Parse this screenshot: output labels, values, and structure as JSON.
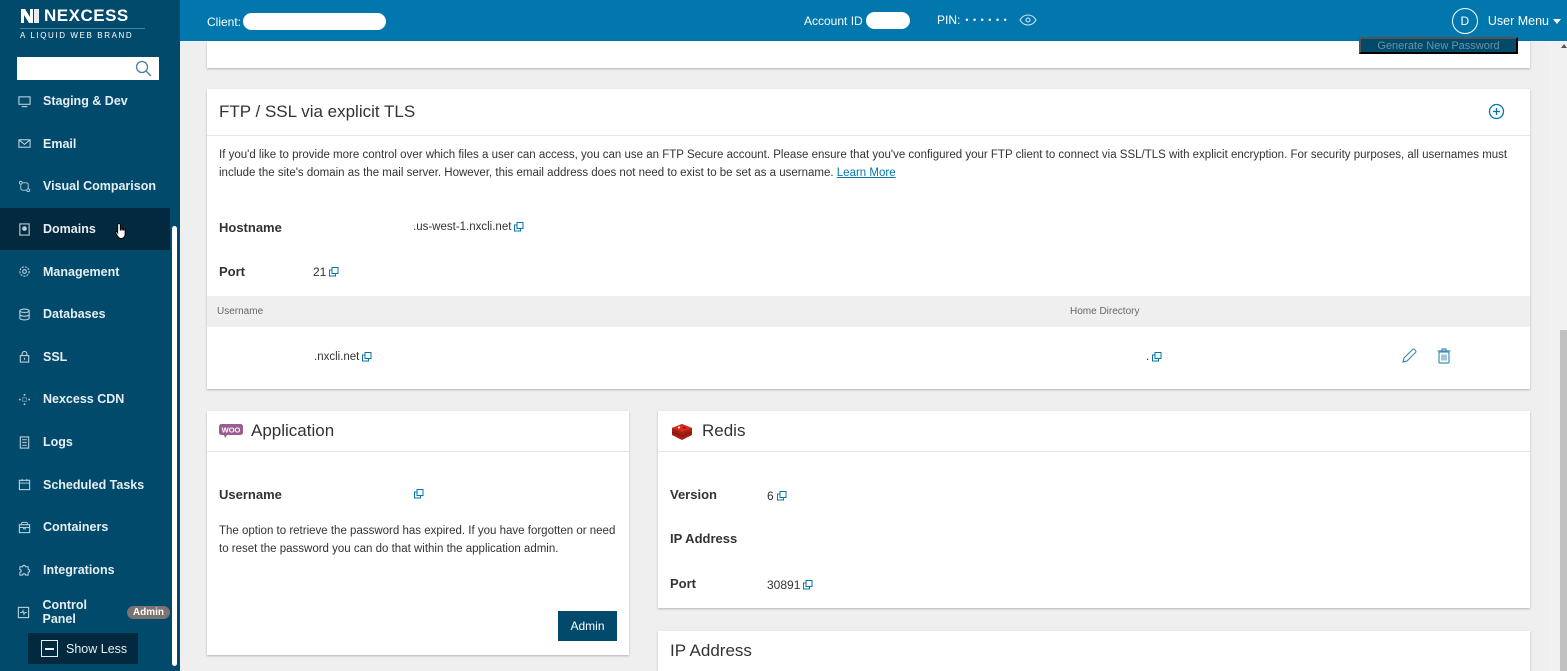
{
  "brand": {
    "name": "NEXCESS",
    "tagline": "A LIQUID WEB BRAND"
  },
  "sidebar": {
    "search_placeholder": "",
    "items": [
      {
        "label": "Staging & Dev",
        "icon": "monitor-icon",
        "active": false
      },
      {
        "label": "Email",
        "icon": "envelope-icon",
        "active": false
      },
      {
        "label": "Visual Comparison",
        "icon": "compare-icon",
        "active": false
      },
      {
        "label": "Domains",
        "icon": "domain-icon",
        "active": true
      },
      {
        "label": "Management",
        "icon": "gear-icon",
        "active": false
      },
      {
        "label": "Databases",
        "icon": "database-icon",
        "active": false
      },
      {
        "label": "SSL",
        "icon": "lock-icon",
        "active": false
      },
      {
        "label": "Nexcess CDN",
        "icon": "cdn-icon",
        "active": false
      },
      {
        "label": "Logs",
        "icon": "log-icon",
        "active": false
      },
      {
        "label": "Scheduled Tasks",
        "icon": "calendar-icon",
        "active": false
      },
      {
        "label": "Containers",
        "icon": "container-icon",
        "active": false
      },
      {
        "label": "Integrations",
        "icon": "puzzle-icon",
        "active": false
      },
      {
        "label": "Control Panel",
        "icon": "control-panel-icon",
        "active": false,
        "badge": "Admin"
      }
    ],
    "show_less_label": "Show Less"
  },
  "topbar": {
    "client_label": "Client:",
    "account_label": "Account ID",
    "pin_label": "PIN:",
    "pin_value": "• • • • • •",
    "avatar_initial": "D",
    "user_menu_label": "User Menu"
  },
  "top_card": {
    "button_label": "Generate New Password"
  },
  "ftp": {
    "title": "FTP / SSL via explicit TLS",
    "description": "If you'd like to provide more control over which files a user can access, you can use an FTP Secure account. Please ensure that you've configured your FTP client to connect via SSL/TLS with explicit encryption. For security purposes, all usernames must include the site's domain as the mail server. However, this email address does not need to exist to be set as a username.",
    "learn_more": "Learn More",
    "hostname_label": "Hostname",
    "hostname_value": ".us-west-1.nxcli.net",
    "port_label": "Port",
    "port_value": "21",
    "table": {
      "columns": [
        "Username",
        "Home Directory"
      ],
      "rows": [
        {
          "username": ".nxcli.net",
          "home_directory": "."
        }
      ]
    }
  },
  "application": {
    "title": "Application",
    "icon_text": "WOO",
    "username_label": "Username",
    "username_value": "",
    "note": "The option to retrieve the password has expired. If you have forgotten or need to reset the password you can do that within the application admin.",
    "admin_button": "Admin"
  },
  "redis": {
    "title": "Redis",
    "version_label": "Version",
    "version_value": "6",
    "ip_label": "IP Address",
    "ip_value": "",
    "port_label": "Port",
    "port_value": "30891"
  },
  "ip_card": {
    "title": "IP Address"
  },
  "colors": {
    "sidebar": "#014a6c",
    "topbar": "#0277ad",
    "active": "#02293d",
    "button": "#014a6c",
    "woo": "#9b5c8f",
    "redis": "#c6302b"
  }
}
